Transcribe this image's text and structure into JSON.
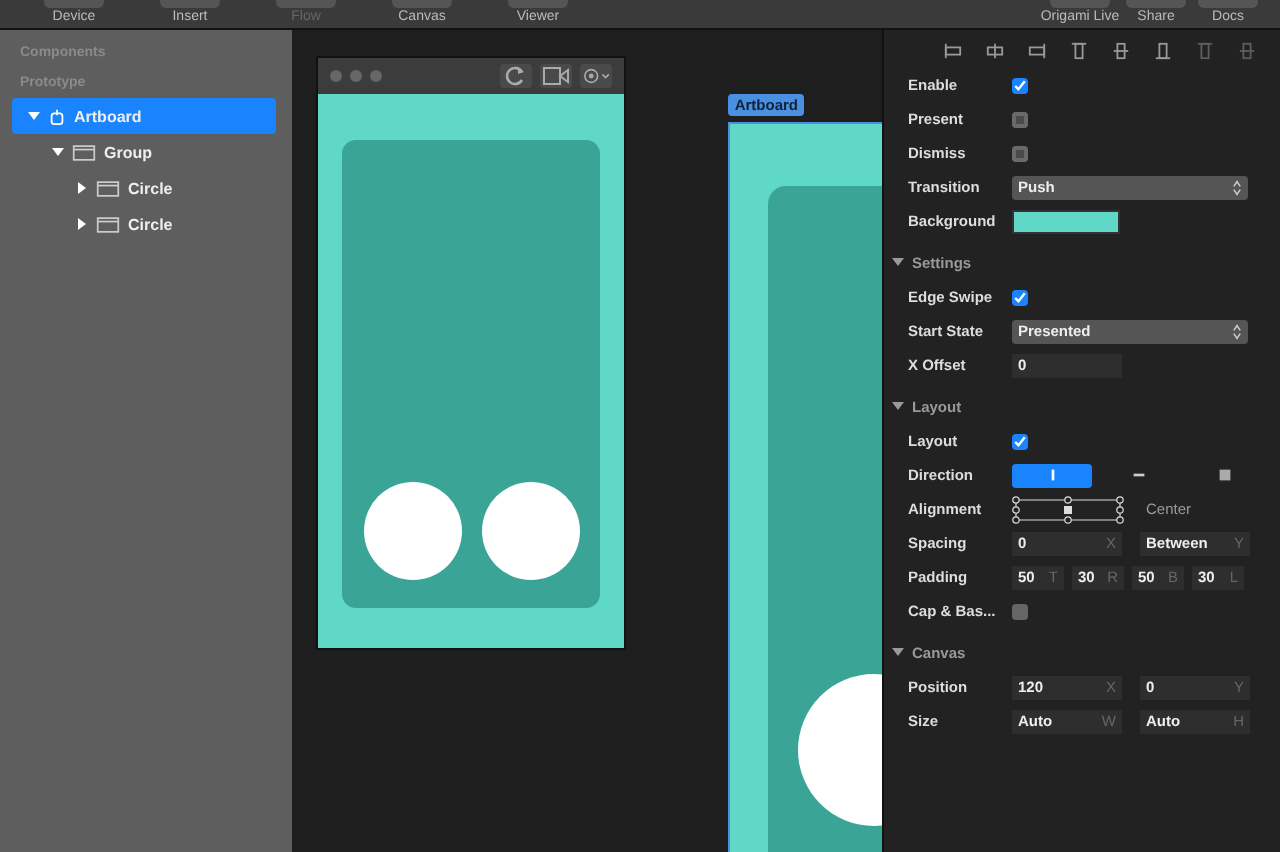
{
  "toolbar": {
    "items": [
      {
        "label": "Device",
        "disabled": false
      },
      {
        "label": "Insert",
        "disabled": false
      },
      {
        "label": "Flow",
        "disabled": true
      },
      {
        "label": "Canvas",
        "disabled": false
      },
      {
        "label": "Viewer",
        "disabled": false
      },
      {
        "label": "Origami Live",
        "disabled": false
      },
      {
        "label": "Share",
        "disabled": false
      },
      {
        "label": "Docs",
        "disabled": false
      }
    ]
  },
  "sidebar": {
    "sections": [
      "Components",
      "Prototype"
    ],
    "tree": [
      {
        "label": "Artboard",
        "kind": "artboard",
        "selected": true,
        "expanded": true,
        "children": [
          {
            "label": "Group",
            "kind": "layer",
            "selected": false,
            "expanded": true,
            "children": [
              {
                "label": "Circle",
                "kind": "layer",
                "selected": false,
                "expanded": false
              },
              {
                "label": "Circle",
                "kind": "layer",
                "selected": false,
                "expanded": false
              }
            ]
          }
        ]
      }
    ]
  },
  "canvas": {
    "artboard_label": "Artboard"
  },
  "inspector": {
    "sections": [
      {
        "rows": [
          {
            "kind": "checkbox",
            "label": "Enable",
            "checked": true
          },
          {
            "kind": "checkbox",
            "label": "Present",
            "checked": false,
            "disabled": true
          },
          {
            "kind": "checkbox",
            "label": "Dismiss",
            "checked": false,
            "disabled": true
          },
          {
            "kind": "select",
            "label": "Transition",
            "value": "Push"
          },
          {
            "kind": "color",
            "label": "Background",
            "color": "#5fd8c8"
          }
        ]
      },
      {
        "title": "Settings",
        "expanded": true,
        "rows": [
          {
            "kind": "checkbox",
            "label": "Edge Swipe",
            "checked": true
          },
          {
            "kind": "select",
            "label": "Start State",
            "value": "Presented"
          },
          {
            "kind": "fields",
            "label": "X Offset",
            "fields": [
              {
                "value": "0"
              }
            ]
          }
        ]
      },
      {
        "title": "Layout",
        "expanded": true,
        "rows": [
          {
            "kind": "checkbox",
            "label": "Layout",
            "checked": true
          },
          {
            "kind": "direction",
            "label": "Direction",
            "options": [
              {
                "selected": true
              },
              {
                "selected": false
              },
              {
                "selected": false
              }
            ]
          },
          {
            "kind": "alignment",
            "label": "Alignment",
            "value": "Center"
          },
          {
            "kind": "fields",
            "label": "Spacing",
            "fields": [
              {
                "value": "0",
                "unit": "X"
              },
              {
                "value": "Between",
                "unit": "Y"
              }
            ]
          },
          {
            "kind": "fields",
            "label": "Padding",
            "fields": [
              {
                "value": "50",
                "unit": "T"
              },
              {
                "value": "30",
                "unit": "R"
              },
              {
                "value": "50",
                "unit": "B"
              },
              {
                "value": "30",
                "unit": "L"
              }
            ]
          },
          {
            "kind": "checkbox",
            "label": "Cap & Bas...",
            "checked": false
          }
        ]
      },
      {
        "title": "Canvas",
        "expanded": true,
        "rows": [
          {
            "kind": "fields",
            "label": "Position",
            "fields": [
              {
                "value": "120",
                "unit": "X"
              },
              {
                "value": "0",
                "unit": "Y"
              }
            ]
          },
          {
            "kind": "fields",
            "label": "Size",
            "fields": [
              {
                "value": "Auto",
                "unit": "W"
              },
              {
                "value": "Auto",
                "unit": "H"
              }
            ]
          }
        ]
      }
    ]
  }
}
